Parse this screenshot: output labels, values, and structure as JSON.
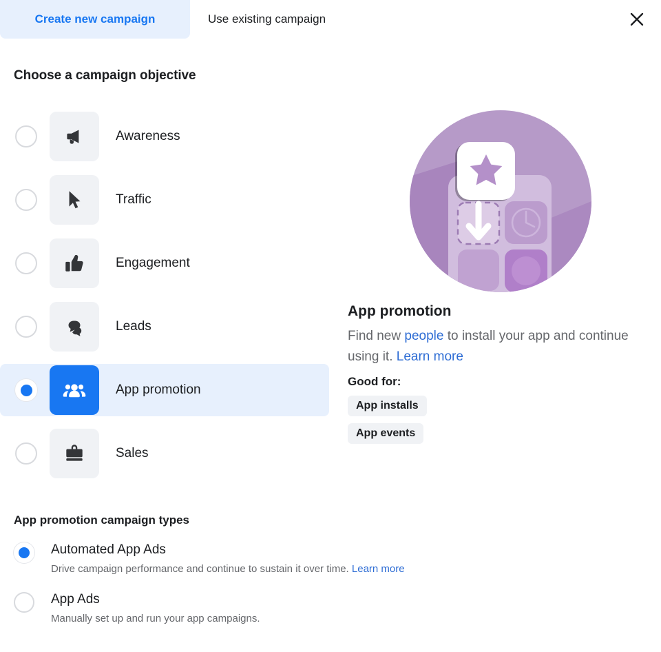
{
  "tabs": [
    {
      "label": "Create new campaign",
      "active": true
    },
    {
      "label": "Use existing campaign",
      "active": false
    }
  ],
  "close_icon": "close-icon",
  "objective_section": {
    "heading": "Choose a campaign objective",
    "items": [
      {
        "label": "Awareness",
        "icon": "megaphone-icon",
        "selected": false
      },
      {
        "label": "Traffic",
        "icon": "cursor-icon",
        "selected": false
      },
      {
        "label": "Engagement",
        "icon": "thumbs-up-icon",
        "selected": false
      },
      {
        "label": "Leads",
        "icon": "speech-bubbles-icon",
        "selected": false
      },
      {
        "label": "App promotion",
        "icon": "people-group-icon",
        "selected": true
      },
      {
        "label": "Sales",
        "icon": "briefcase-icon",
        "selected": false
      }
    ]
  },
  "detail": {
    "illustration": "app-install-illustration",
    "title": "App promotion",
    "desc_part1": "Find new ",
    "desc_link1": "people",
    "desc_part2": " to install your app and continue using it. ",
    "desc_link2": "Learn more",
    "good_for_label": "Good for:",
    "chips": [
      "App installs",
      "App events"
    ]
  },
  "types_section": {
    "heading": "App promotion campaign types",
    "options": [
      {
        "label": "Automated App Ads",
        "desc": "Drive campaign performance and continue to sustain it over time. ",
        "desc_link": "Learn more",
        "selected": true
      },
      {
        "label": "App Ads",
        "desc": "Manually set up and run your app campaigns.",
        "desc_link": "",
        "selected": false
      }
    ]
  },
  "colors": {
    "accent_blue": "#1877f2",
    "link_blue": "#2d6cd4",
    "tab_active_bg": "#e7f0fd",
    "tile_gray": "#f0f2f5",
    "text_primary": "#1c1e21",
    "text_secondary": "#65676b",
    "illustration_purple": "#b69ac8"
  }
}
